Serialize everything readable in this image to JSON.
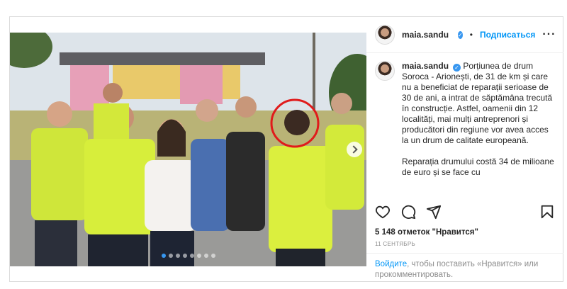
{
  "post": {
    "username": "maia.sandu",
    "follow_label": "Подписаться",
    "separator": "•",
    "caption_paragraphs": [
      "Porțiunea de drum Soroca - Arionești, de 31 de km și care nu a beneficiat de reparații serioase de 30 de ani, a intrat de săptămâna trecută în construcție. Astfel, oamenii din 12 localități, mai mulți antreprenori și producători din regiune vor avea acces la un drum de calitate europeană.",
      "Reparația drumului costă 34 de milioane de euro și se face cu"
    ],
    "likes": "5 148 отметок \"Нравится\"",
    "date": "11 СЕНТЯБРЬ",
    "login_link": "Войдите",
    "login_text": ", чтобы поставить «Нравится» или прокомментировать."
  },
  "carousel": {
    "slide_count": 8,
    "active_index": 0
  },
  "icons": {
    "like": "heart-icon",
    "comment": "comment-icon",
    "share": "share-icon",
    "save": "bookmark-icon",
    "options": "more-options-icon",
    "verified": "verified-badge-icon",
    "next": "chevron-right-icon"
  },
  "colors": {
    "link": "#0095f6",
    "verified": "#3897f0",
    "highlight_circle": "#e01b1b",
    "vest": "#d8ef3a"
  }
}
